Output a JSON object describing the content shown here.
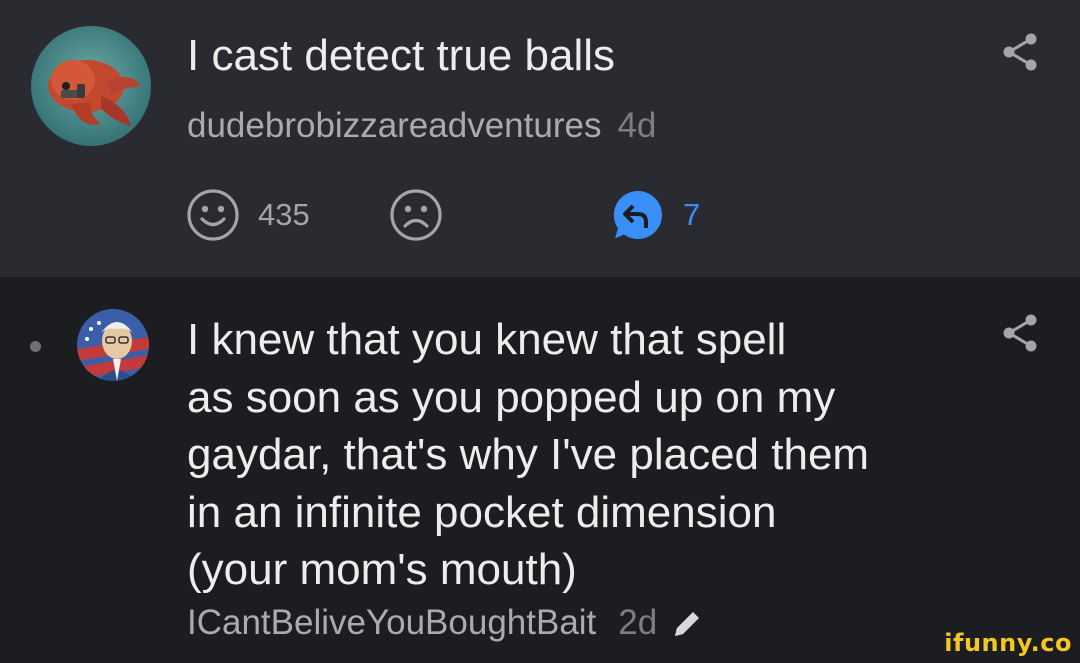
{
  "post": {
    "title": "I cast detect true balls",
    "username": "dudebrobizzareadventures",
    "age": "4d",
    "likes": "435",
    "replies": "7",
    "icons": {
      "avatar": "octopus-avatar",
      "share": "share-icon",
      "like": "smiley-icon",
      "dislike": "frown-icon",
      "reply": "reply-bubble-icon"
    }
  },
  "reply": {
    "lines": [
      "I knew that you knew that spell",
      "as soon as you popped up on my",
      "gaydar, that's why I've placed them",
      "in an infinite pocket dimension",
      "(your mom's mouth)"
    ],
    "username": "ICantBeliveYouBoughtBait",
    "age": "2d",
    "icons": {
      "avatar": "user-avatar",
      "share": "share-icon",
      "edit": "pencil-icon",
      "thread": "thread-bullet"
    }
  },
  "watermark": "ifunny.co",
  "colors": {
    "post_bg": "#2a2b30",
    "reply_bg": "#1c1d21",
    "accent_blue": "#3a8ff7",
    "watermark_yellow": "#f3c623"
  }
}
